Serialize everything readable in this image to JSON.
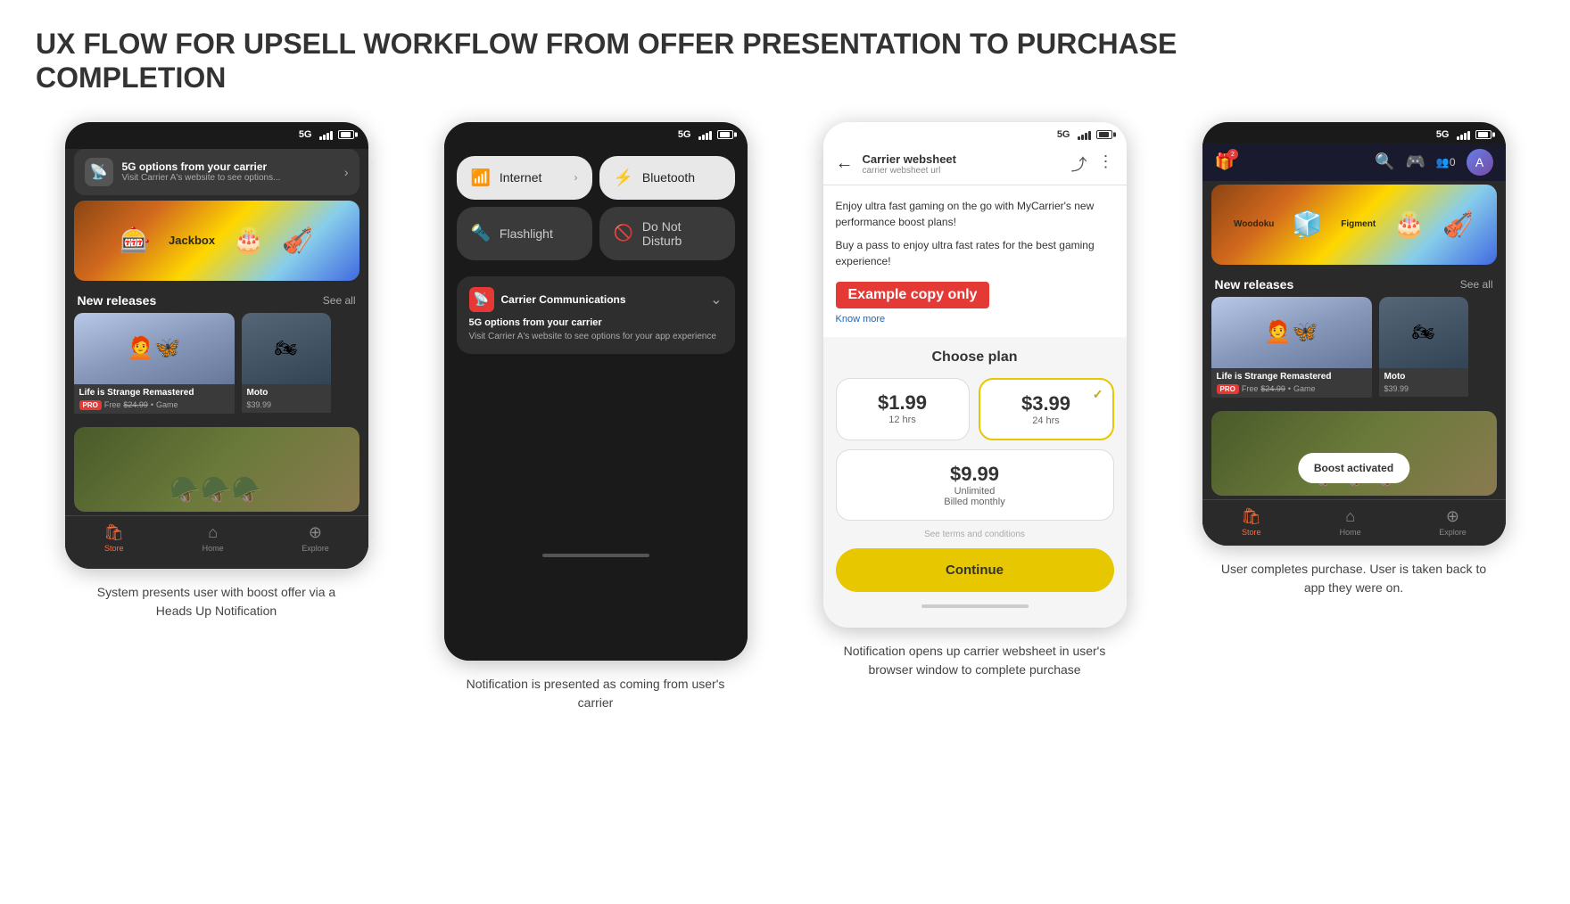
{
  "page": {
    "title": "UX FLOW FOR UPSELL WORKFLOW FROM OFFER PRESENTATION TO PURCHASE COMPLETION"
  },
  "screen1": {
    "status": "5G",
    "notification": {
      "title": "5G options from your carrier",
      "subtitle": "Visit Carrier A's website to see options..."
    },
    "new_releases_label": "New releases",
    "see_all": "See all",
    "game1": {
      "name": "Life is Strange Remastered",
      "badge": "PRO",
      "price": "Free",
      "original_price": "$24.99",
      "type": "Game"
    },
    "game2": {
      "name": "Moto",
      "price": "$39.99"
    },
    "nav": {
      "store": "Store",
      "home": "Home",
      "explore": "Explore"
    },
    "description": "System presents user with boost offer via a Heads Up Notification"
  },
  "screen2": {
    "status": "5G",
    "tiles": [
      {
        "label": "Internet",
        "active": true,
        "has_arrow": true,
        "icon": "wifi"
      },
      {
        "label": "Bluetooth",
        "active": true,
        "has_arrow": false,
        "icon": "bluetooth"
      },
      {
        "label": "Flashlight",
        "active": false,
        "has_arrow": false,
        "icon": "flashlight"
      },
      {
        "label": "Do Not Disturb",
        "active": false,
        "has_arrow": false,
        "icon": "dnd"
      }
    ],
    "carrier_notif": {
      "title": "Carrier Communications",
      "msg_title": "5G options from your carrier",
      "msg_body": "Visit Carrier A's website to see options for your app experience"
    },
    "description": "Notification is presented as coming from user's carrier"
  },
  "screen3": {
    "status": "5G",
    "header": {
      "title": "Carrier websheet",
      "url": "carrier websheet url"
    },
    "promo": "Enjoy ultra fast gaming on the go with MyCarrier's new performance boost plans!",
    "promo2": "Buy a pass to enjoy ultra fast rates for the best gaming experience!",
    "know_more": "Know more",
    "example_label": "Example copy only",
    "choose_plan": "Choose plan",
    "plans": [
      {
        "price": "$1.99",
        "duration": "12 hrs"
      },
      {
        "price": "$3.99",
        "duration": "24 hrs",
        "selected": true
      },
      {
        "price": "$9.99",
        "duration": "Unlimited",
        "sub": "Billed monthly"
      }
    ],
    "terms": "See terms and conditions",
    "continue_btn": "Continue",
    "description": "Notification opens up carrier websheet in user's browser window to complete purchase"
  },
  "screen4": {
    "status": "5G",
    "boost_popup": "Boost activated",
    "new_releases_label": "New releases",
    "see_all": "See all",
    "game1": {
      "name": "Life is Strange Remastered",
      "badge": "PRO",
      "price": "Free",
      "original_price": "$24.99",
      "type": "Game"
    },
    "game2": {
      "name": "Moto",
      "price": "$39.99"
    },
    "nav": {
      "store": "Store",
      "home": "Home",
      "explore": "Explore"
    },
    "description": "User completes purchase. User is taken back to app they were on."
  }
}
